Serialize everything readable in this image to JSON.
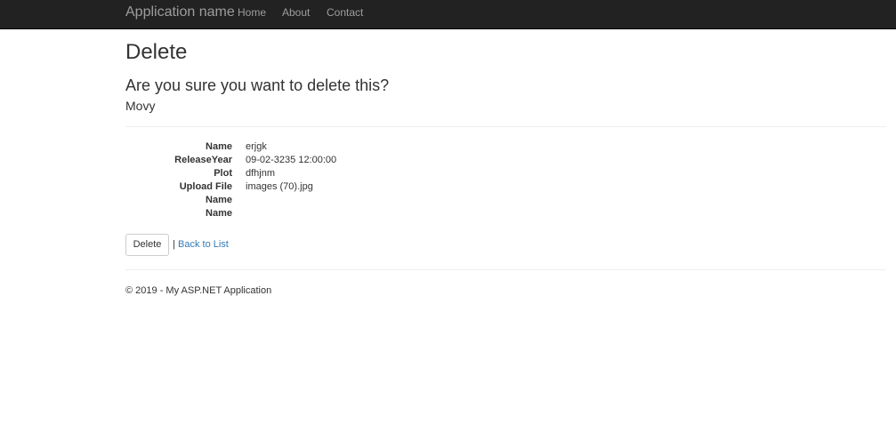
{
  "navbar": {
    "brand": "Application name",
    "links": [
      "Home",
      "About",
      "Contact"
    ]
  },
  "page": {
    "title": "Delete",
    "confirm_question": "Are you sure you want to delete this?",
    "entity_name": "Movy"
  },
  "details": [
    {
      "label": "Name",
      "value": "erjgk"
    },
    {
      "label": "ReleaseYear",
      "value": "09-02-3235 12:00:00"
    },
    {
      "label": "Plot",
      "value": "dfhjnm"
    },
    {
      "label": "Upload File",
      "value": "images (70).jpg"
    },
    {
      "label": "Name",
      "value": ""
    },
    {
      "label": "Name",
      "value": ""
    }
  ],
  "actions": {
    "delete_label": "Delete",
    "separator": "|",
    "back_label": "Back to List"
  },
  "footer": {
    "text": "© 2019 - My ASP.NET Application"
  }
}
